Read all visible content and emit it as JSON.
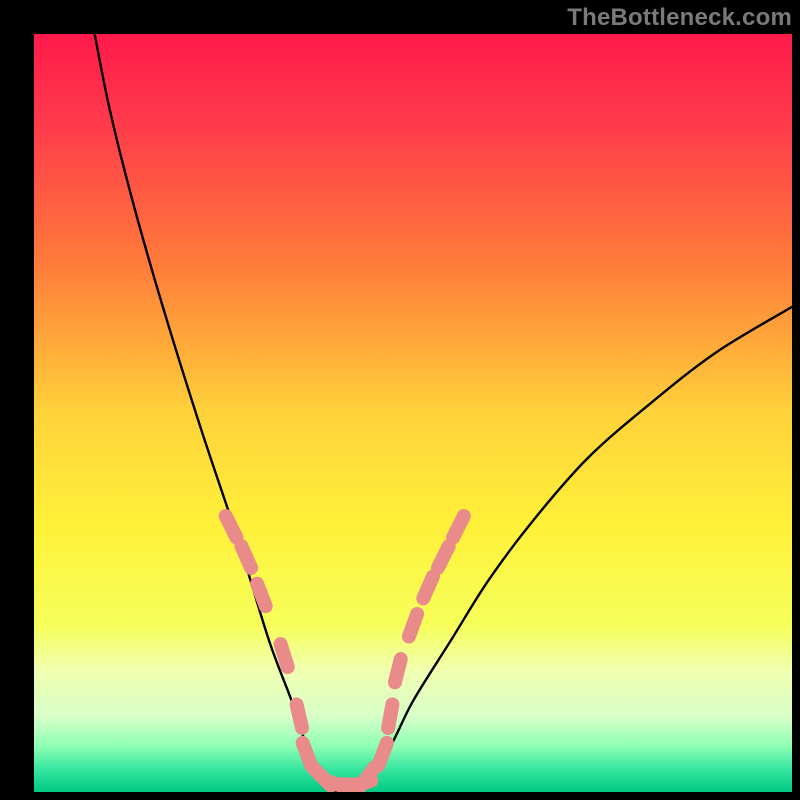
{
  "watermark": "TheBottleneck.com",
  "chart_data": {
    "type": "line",
    "title": "",
    "xlabel": "",
    "ylabel": "",
    "xlim": [
      0,
      100
    ],
    "ylim": [
      0,
      100
    ],
    "series": [
      {
        "name": "bottleneck-curve",
        "x": [
          8,
          10,
          13,
          17,
          22,
          27,
          31,
          34,
          36,
          38,
          40,
          42,
          44,
          47,
          50,
          55,
          60,
          66,
          73,
          81,
          90,
          100
        ],
        "y": [
          100,
          90,
          78,
          64,
          48,
          33,
          20,
          12,
          6,
          2,
          0,
          0,
          2,
          6,
          12,
          20,
          28,
          36,
          44,
          51,
          58,
          64
        ]
      }
    ],
    "markers": {
      "name": "highlight-points",
      "color": "#e98b8b",
      "x": [
        26,
        28,
        30,
        33,
        35,
        36,
        38,
        40,
        41,
        43,
        44,
        46,
        47,
        48,
        50,
        52,
        54,
        56
      ],
      "y": [
        35,
        31,
        26,
        18,
        10,
        5,
        2,
        1,
        1,
        1,
        2,
        5,
        10,
        16,
        22,
        27,
        31,
        35
      ]
    },
    "background_gradient": {
      "stops": [
        {
          "offset": 0.0,
          "color": "#ff1a4b"
        },
        {
          "offset": 0.12,
          "color": "#ff3b4b"
        },
        {
          "offset": 0.3,
          "color": "#ff7a3a"
        },
        {
          "offset": 0.5,
          "color": "#ffd23a"
        },
        {
          "offset": 0.65,
          "color": "#fff13a"
        },
        {
          "offset": 0.78,
          "color": "#f6ff5a"
        },
        {
          "offset": 0.84,
          "color": "#f0ffb0"
        },
        {
          "offset": 0.9,
          "color": "#d8ffc8"
        },
        {
          "offset": 0.94,
          "color": "#8dffb5"
        },
        {
          "offset": 0.97,
          "color": "#36e6a0"
        },
        {
          "offset": 1.0,
          "color": "#00c884"
        }
      ]
    }
  }
}
